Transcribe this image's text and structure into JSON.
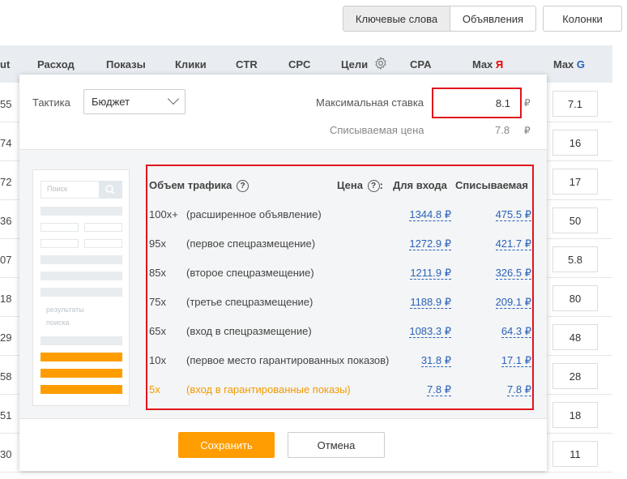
{
  "toolbar": {
    "keywords_label": "Ключевые слова",
    "ads_label": "Объявления",
    "columns_label": "Колонки"
  },
  "table": {
    "headers": {
      "cut": "ut",
      "spend": "Расход",
      "impressions": "Показы",
      "clicks": "Клики",
      "ctr": "CTR",
      "cpc": "CPC",
      "goals": "Цели",
      "cpa": "CPA",
      "max_ya_prefix": "Max ",
      "max_ya_letter": "Я",
      "max_g_prefix": "Max ",
      "max_g_letter": "G"
    },
    "left_values": [
      "55",
      "74",
      "72",
      "36",
      "07",
      "18",
      "29",
      "58",
      "51",
      "30"
    ],
    "max_g_values": [
      "7.1",
      "16",
      "17",
      "50",
      "5.8",
      "80",
      "48",
      "28",
      "18",
      "11"
    ]
  },
  "modal": {
    "tactic_label": "Тактика",
    "tactic_value": "Бюджет",
    "max_bid_label": "Максимальная ставка",
    "max_bid_value": "8.1",
    "charged_price_label": "Списываемая цена",
    "charged_price_value": "7.8",
    "currency": "₽",
    "preview": {
      "search_placeholder": "Поиск",
      "results_line1": "результаты",
      "results_line2": "поиска"
    },
    "traffic": {
      "header_volume": "Объем трафика",
      "header_price": "Цена",
      "header_price_colon": ":",
      "header_entry": "Для входа",
      "header_charged": "Списываемая",
      "rows": [
        {
          "volume": "100x+",
          "desc": "(расширенное объявление)",
          "entry": "1344.8 ₽",
          "charged": "475.5 ₽"
        },
        {
          "volume": "95x",
          "desc": "(первое спецразмещение)",
          "entry": "1272.9 ₽",
          "charged": "421.7 ₽"
        },
        {
          "volume": "85x",
          "desc": "(второе спецразмещение)",
          "entry": "1211.9 ₽",
          "charged": "326.5 ₽"
        },
        {
          "volume": "75x",
          "desc": "(третье спецразмещение)",
          "entry": "1188.9 ₽",
          "charged": "209.1 ₽"
        },
        {
          "volume": "65x",
          "desc": "(вход в спецразмещение)",
          "entry": "1083.3 ₽",
          "charged": "64.3 ₽"
        },
        {
          "volume": "10x",
          "desc": "(первое место гарантированных показов)",
          "entry": "31.8 ₽",
          "charged": "17.1 ₽"
        },
        {
          "volume": "5x",
          "desc": "(вход в гарантированные показы)",
          "entry": "7.8 ₽",
          "charged": "7.8 ₽"
        }
      ]
    },
    "save_label": "Сохранить",
    "cancel_label": "Отмена"
  },
  "colors": {
    "accent_orange": "#ff9d00",
    "highlight_red": "#e0151d",
    "link_blue": "#2a62b8"
  }
}
